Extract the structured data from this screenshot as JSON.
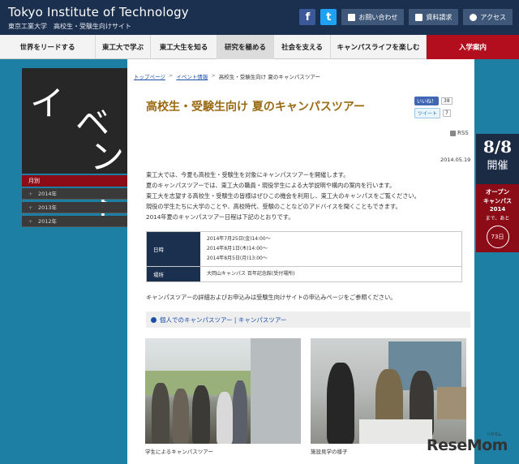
{
  "header": {
    "logo_en": "Tokyo Institute of Technology",
    "logo_jp": "東京工業大学　高校生・受験生向けサイト",
    "buttons": [
      "お問い合わせ",
      "資料請求",
      "アクセス"
    ]
  },
  "nav": {
    "items": [
      "世界をリードする",
      "東工大で学ぶ",
      "東工大生を知る",
      "研究を極める",
      "社会を支える",
      "キャンパスライフを楽しむ",
      "入学案内"
    ]
  },
  "sidebar": {
    "event_kana": [
      "イ",
      "ベ",
      "ント"
    ],
    "monthly_label": "月別",
    "years": [
      "2014年",
      "2013年",
      "2012年"
    ]
  },
  "breadcrumb": {
    "top": "トップページ",
    "sep": ">",
    "events": "イベント情報",
    "current": "高校生・受験生向け 夏のキャンパスツアー"
  },
  "article": {
    "title": "高校生・受験生向け 夏のキャンパスツアー",
    "like_label": "いいね！",
    "like_count": "38",
    "tweet_label": "ツイート",
    "tweet_count": "7",
    "rss": "RSS",
    "date": "2014.05.19",
    "paragraphs": [
      "東工大では、今夏も高校生・受験生を対象にキャンパスツアーを開催します。",
      "夏のキャンパスツアーでは、東工大の職員・現役学生による大学説明や構内の案内を行います。",
      "東工大を志望する高校生・受験生の皆様はぜひこの機会を利用し、東工大のキャンパスをご覧ください。",
      "現役の学生たちに大学のことや、高校時代、受験のことなどのアドバイスを聞くこともできます。",
      "2014年夏のキャンパスツアー日程は下記のとおりです。"
    ],
    "table": {
      "date_label": "日時",
      "dates": [
        "2014年7月25日(金)14:00～",
        "2014年8月1日(木)14:00～",
        "2014年8月5日(月)13:00～"
      ],
      "place_label": "場所",
      "place": "大岡山キャンパス 百年記念館(受付場所)"
    },
    "note": "キャンパスツアーの詳細およびお申込みは受験生向けサイトの申込みページをご参照ください。",
    "section_link": "個人でのキャンパスツアー | キャンパスツアー",
    "captions": [
      "学生によるキャンパスツアー",
      "施設見学の様子"
    ]
  },
  "open_campus": {
    "date": "8/8",
    "kai": "開催",
    "title1": "オープン",
    "title2": "キャンパス",
    "year": "2014",
    "until": "まで、あと",
    "days": "73日"
  },
  "watermark": {
    "brand": "ReseMom",
    "sub": "リセマム"
  }
}
